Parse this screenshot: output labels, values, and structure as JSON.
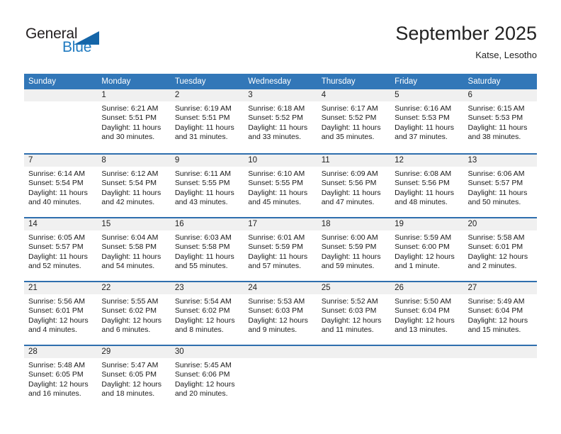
{
  "brand": {
    "name_part1": "General",
    "name_part2": "Blue",
    "triangle_color": "#1565a8",
    "blue_color": "#1f7ac0"
  },
  "header": {
    "title": "September 2025",
    "subtitle": "Katse, Lesotho"
  },
  "theme": {
    "header_row_bg": "#3277b8",
    "week_separator": "#2f6fae",
    "day_band_bg": "#f0f0f0",
    "text": "#1a1a1a"
  },
  "weekdays": [
    "Sunday",
    "Monday",
    "Tuesday",
    "Wednesday",
    "Thursday",
    "Friday",
    "Saturday"
  ],
  "weeks": [
    {
      "days": [
        {
          "num": "",
          "empty": true,
          "lines": []
        },
        {
          "num": "1",
          "empty": false,
          "lines": [
            "Sunrise: 6:21 AM",
            "Sunset: 5:51 PM",
            "Daylight: 11 hours",
            "and 30 minutes."
          ]
        },
        {
          "num": "2",
          "empty": false,
          "lines": [
            "Sunrise: 6:19 AM",
            "Sunset: 5:51 PM",
            "Daylight: 11 hours",
            "and 31 minutes."
          ]
        },
        {
          "num": "3",
          "empty": false,
          "lines": [
            "Sunrise: 6:18 AM",
            "Sunset: 5:52 PM",
            "Daylight: 11 hours",
            "and 33 minutes."
          ]
        },
        {
          "num": "4",
          "empty": false,
          "lines": [
            "Sunrise: 6:17 AM",
            "Sunset: 5:52 PM",
            "Daylight: 11 hours",
            "and 35 minutes."
          ]
        },
        {
          "num": "5",
          "empty": false,
          "lines": [
            "Sunrise: 6:16 AM",
            "Sunset: 5:53 PM",
            "Daylight: 11 hours",
            "and 37 minutes."
          ]
        },
        {
          "num": "6",
          "empty": false,
          "lines": [
            "Sunrise: 6:15 AM",
            "Sunset: 5:53 PM",
            "Daylight: 11 hours",
            "and 38 minutes."
          ]
        }
      ]
    },
    {
      "days": [
        {
          "num": "7",
          "empty": false,
          "lines": [
            "Sunrise: 6:14 AM",
            "Sunset: 5:54 PM",
            "Daylight: 11 hours",
            "and 40 minutes."
          ]
        },
        {
          "num": "8",
          "empty": false,
          "lines": [
            "Sunrise: 6:12 AM",
            "Sunset: 5:54 PM",
            "Daylight: 11 hours",
            "and 42 minutes."
          ]
        },
        {
          "num": "9",
          "empty": false,
          "lines": [
            "Sunrise: 6:11 AM",
            "Sunset: 5:55 PM",
            "Daylight: 11 hours",
            "and 43 minutes."
          ]
        },
        {
          "num": "10",
          "empty": false,
          "lines": [
            "Sunrise: 6:10 AM",
            "Sunset: 5:55 PM",
            "Daylight: 11 hours",
            "and 45 minutes."
          ]
        },
        {
          "num": "11",
          "empty": false,
          "lines": [
            "Sunrise: 6:09 AM",
            "Sunset: 5:56 PM",
            "Daylight: 11 hours",
            "and 47 minutes."
          ]
        },
        {
          "num": "12",
          "empty": false,
          "lines": [
            "Sunrise: 6:08 AM",
            "Sunset: 5:56 PM",
            "Daylight: 11 hours",
            "and 48 minutes."
          ]
        },
        {
          "num": "13",
          "empty": false,
          "lines": [
            "Sunrise: 6:06 AM",
            "Sunset: 5:57 PM",
            "Daylight: 11 hours",
            "and 50 minutes."
          ]
        }
      ]
    },
    {
      "days": [
        {
          "num": "14",
          "empty": false,
          "lines": [
            "Sunrise: 6:05 AM",
            "Sunset: 5:57 PM",
            "Daylight: 11 hours",
            "and 52 minutes."
          ]
        },
        {
          "num": "15",
          "empty": false,
          "lines": [
            "Sunrise: 6:04 AM",
            "Sunset: 5:58 PM",
            "Daylight: 11 hours",
            "and 54 minutes."
          ]
        },
        {
          "num": "16",
          "empty": false,
          "lines": [
            "Sunrise: 6:03 AM",
            "Sunset: 5:58 PM",
            "Daylight: 11 hours",
            "and 55 minutes."
          ]
        },
        {
          "num": "17",
          "empty": false,
          "lines": [
            "Sunrise: 6:01 AM",
            "Sunset: 5:59 PM",
            "Daylight: 11 hours",
            "and 57 minutes."
          ]
        },
        {
          "num": "18",
          "empty": false,
          "lines": [
            "Sunrise: 6:00 AM",
            "Sunset: 5:59 PM",
            "Daylight: 11 hours",
            "and 59 minutes."
          ]
        },
        {
          "num": "19",
          "empty": false,
          "lines": [
            "Sunrise: 5:59 AM",
            "Sunset: 6:00 PM",
            "Daylight: 12 hours",
            "and 1 minute."
          ]
        },
        {
          "num": "20",
          "empty": false,
          "lines": [
            "Sunrise: 5:58 AM",
            "Sunset: 6:01 PM",
            "Daylight: 12 hours",
            "and 2 minutes."
          ]
        }
      ]
    },
    {
      "days": [
        {
          "num": "21",
          "empty": false,
          "lines": [
            "Sunrise: 5:56 AM",
            "Sunset: 6:01 PM",
            "Daylight: 12 hours",
            "and 4 minutes."
          ]
        },
        {
          "num": "22",
          "empty": false,
          "lines": [
            "Sunrise: 5:55 AM",
            "Sunset: 6:02 PM",
            "Daylight: 12 hours",
            "and 6 minutes."
          ]
        },
        {
          "num": "23",
          "empty": false,
          "lines": [
            "Sunrise: 5:54 AM",
            "Sunset: 6:02 PM",
            "Daylight: 12 hours",
            "and 8 minutes."
          ]
        },
        {
          "num": "24",
          "empty": false,
          "lines": [
            "Sunrise: 5:53 AM",
            "Sunset: 6:03 PM",
            "Daylight: 12 hours",
            "and 9 minutes."
          ]
        },
        {
          "num": "25",
          "empty": false,
          "lines": [
            "Sunrise: 5:52 AM",
            "Sunset: 6:03 PM",
            "Daylight: 12 hours",
            "and 11 minutes."
          ]
        },
        {
          "num": "26",
          "empty": false,
          "lines": [
            "Sunrise: 5:50 AM",
            "Sunset: 6:04 PM",
            "Daylight: 12 hours",
            "and 13 minutes."
          ]
        },
        {
          "num": "27",
          "empty": false,
          "lines": [
            "Sunrise: 5:49 AM",
            "Sunset: 6:04 PM",
            "Daylight: 12 hours",
            "and 15 minutes."
          ]
        }
      ]
    },
    {
      "days": [
        {
          "num": "28",
          "empty": false,
          "lines": [
            "Sunrise: 5:48 AM",
            "Sunset: 6:05 PM",
            "Daylight: 12 hours",
            "and 16 minutes."
          ]
        },
        {
          "num": "29",
          "empty": false,
          "lines": [
            "Sunrise: 5:47 AM",
            "Sunset: 6:05 PM",
            "Daylight: 12 hours",
            "and 18 minutes."
          ]
        },
        {
          "num": "30",
          "empty": false,
          "lines": [
            "Sunrise: 5:45 AM",
            "Sunset: 6:06 PM",
            "Daylight: 12 hours",
            "and 20 minutes."
          ]
        },
        {
          "num": "",
          "empty": true,
          "lines": []
        },
        {
          "num": "",
          "empty": true,
          "lines": []
        },
        {
          "num": "",
          "empty": true,
          "lines": []
        },
        {
          "num": "",
          "empty": true,
          "lines": []
        }
      ]
    }
  ]
}
